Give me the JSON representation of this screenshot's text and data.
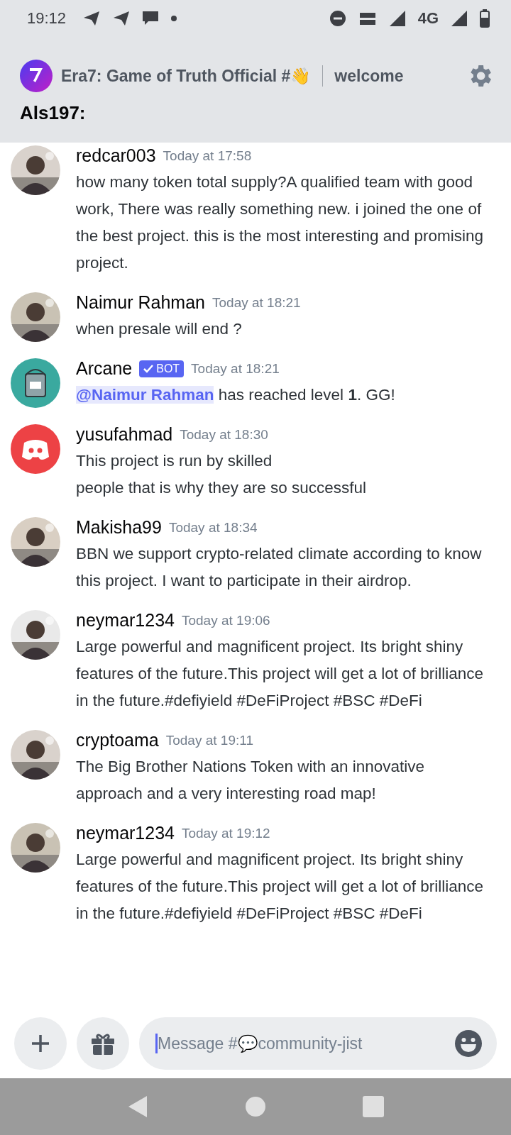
{
  "status_bar": {
    "time": "19:12",
    "network": "4G"
  },
  "header": {
    "server": "Era7: Game of Truth Official #👋",
    "channel": "welcome",
    "subtitle": "Als197:"
  },
  "messages": [
    {
      "author": "redcar003",
      "time": "Today at 17:58",
      "text": "how many token total supply?A qualified team with good work, There was really something new. i joined the one of the best project. this is the most interesting and promising project."
    },
    {
      "author": "Naimur Rahman",
      "time": "Today at 18:21",
      "text": "when presale will end ?"
    },
    {
      "author": "Arcane",
      "time": "Today at 18:21",
      "kind": "bucket",
      "badge": "BOT",
      "mention": "@Naimur Rahman",
      "text": "has reached level **1**. GG!"
    },
    {
      "author": "yusufahmad",
      "time": "Today at 18:30",
      "kind": "default",
      "text": "This project is run by skilled\npeople that is why they are so successful"
    },
    {
      "author": "Makisha99",
      "time": "Today at 18:34",
      "text": "BBN we support crypto-related climate according to know this project. I want to participate in their airdrop."
    },
    {
      "author": "neymar1234",
      "time": "Today at 19:06",
      "text": "Large powerful and magnificent project. Its bright shiny features of the future.This project will get a lot of brilliance in the future.#defiyield #DeFiProject #BSC #DeFi"
    },
    {
      "author": "cryptoama",
      "time": "Today at 19:11",
      "text": "The Big Brother Nations Token with an innovative approach and a very interesting road map!"
    },
    {
      "author": "neymar1234",
      "time": "Today at 19:12",
      "text": "Large powerful and magnificent project. Its bright shiny features of the future.This project will get a lot of brilliance in the future.#defiyield #DeFiProject #BSC #DeFi"
    }
  ],
  "composer": {
    "placeholder": "Message #💬community-jist"
  }
}
